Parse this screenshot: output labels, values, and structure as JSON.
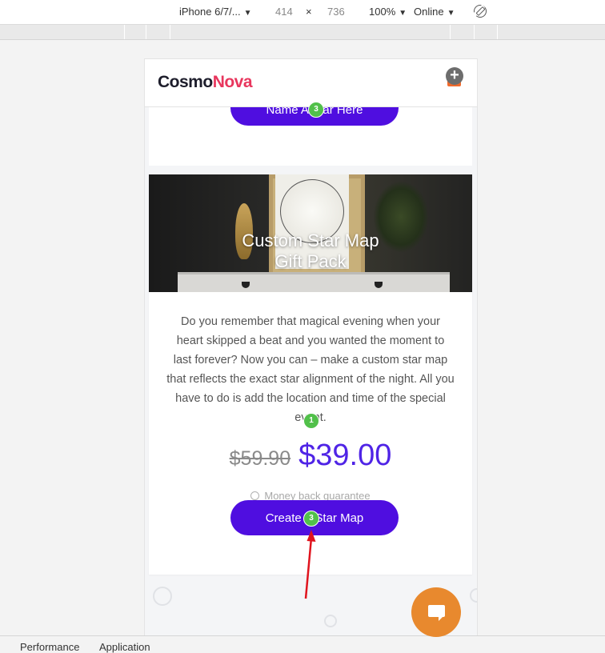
{
  "devtools": {
    "device": "iPhone 6/7/...",
    "width": "414",
    "times": "×",
    "height": "736",
    "zoom": "100%",
    "network": "Online",
    "bottom_tabs": [
      "Performance",
      "Application"
    ]
  },
  "site": {
    "logo_part1": "Cosmo",
    "logo_part2": "Nova",
    "cart_plus": "+",
    "top_button_label": "Name A Star Here",
    "product_title_line1": "Custom Star Map",
    "product_title_line2": "Gift Pack",
    "description": "Do you remember that magical evening when your heart skipped a beat and you wanted the moment to last forever? Now you can – make a custom star map that reflects the exact star alignment of the night. All you have to do is add the location and time of the special event.",
    "price_old": "$59.90",
    "price_new": "$39.00",
    "guarantee": "Money back guarantee",
    "cta_label": "Create A Star Map"
  },
  "markers": {
    "top_button": "3",
    "description": "1",
    "cta_button": "3"
  },
  "colors": {
    "brand_purple": "#4f0ee0",
    "logo_pink": "#e8365d",
    "chat_orange": "#e8892e",
    "marker_green": "#51c04a",
    "arrow_red": "#e0141e"
  }
}
